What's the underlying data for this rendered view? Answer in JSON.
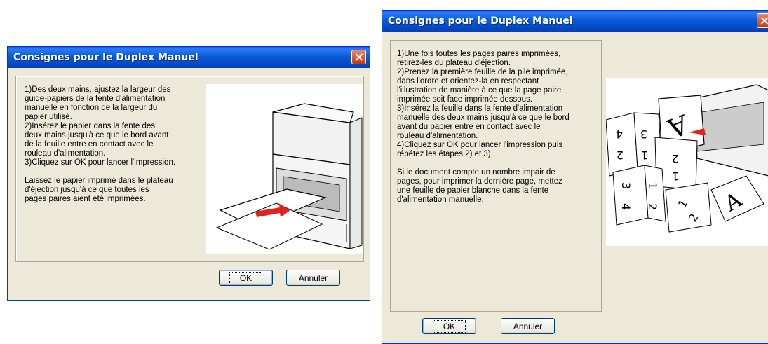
{
  "dialogs": [
    {
      "title": "Consignes pour le Duplex Manuel",
      "message": "1)Des deux mains, ajustez la largeur des\nguide-papiers de la fente d'alimentation\nmanuelle en fonction de la largeur du\npapier utilisé.\n2)Insérez le papier dans la fente des\ndeux mains jusqu'à ce que le bord avant\nde la feuille entre en contact avec le\nrouleau d'alimentation.\n3)Cliquez sur OK pour lancer l'impression.\n\nLaissez le papier imprimé dans le plateau\nd'éjection jusqu'à ce que toutes les\npages paires aient été imprimées.",
      "ok_label": "OK",
      "cancel_label": "Annuler"
    },
    {
      "title": "Consignes pour le Duplex Manuel",
      "message": "1)Une fois toutes les pages paires imprimées,\nretirez-les du plateau d'éjection.\n2)Prenez la première feuille de la pile imprimée,\ndans l'ordre et orientez-la en respectant\nl'illustration de manière à ce que la page paire\nimprimée soit face imprimée dessous.\n3)Insérez la feuille dans la fente d'alimentation\nmanuelle des deux mains jusqu'à ce que le bord\navant du papier entre en contact avec le\nrouleau d'alimentation.\n4)Cliquez sur OK pour lancer l'impression puis\nrépétez les étapes 2) et 3).\n\n Si le document compte un nombre impair de\npages, pour imprimer la dernière page, mettez\nune feuille de papier blanche dans la fente\nd'alimentation manuelle.",
      "ok_label": "OK",
      "cancel_label": "Annuler"
    }
  ],
  "colors": {
    "titlebar": "#0a5ee8",
    "dialog_bg": "#ece9d8",
    "close_button": "#c6390f"
  },
  "icons": [
    "close-icon",
    "printer-manual-feed-illustration",
    "duplex-page-order-illustration"
  ]
}
